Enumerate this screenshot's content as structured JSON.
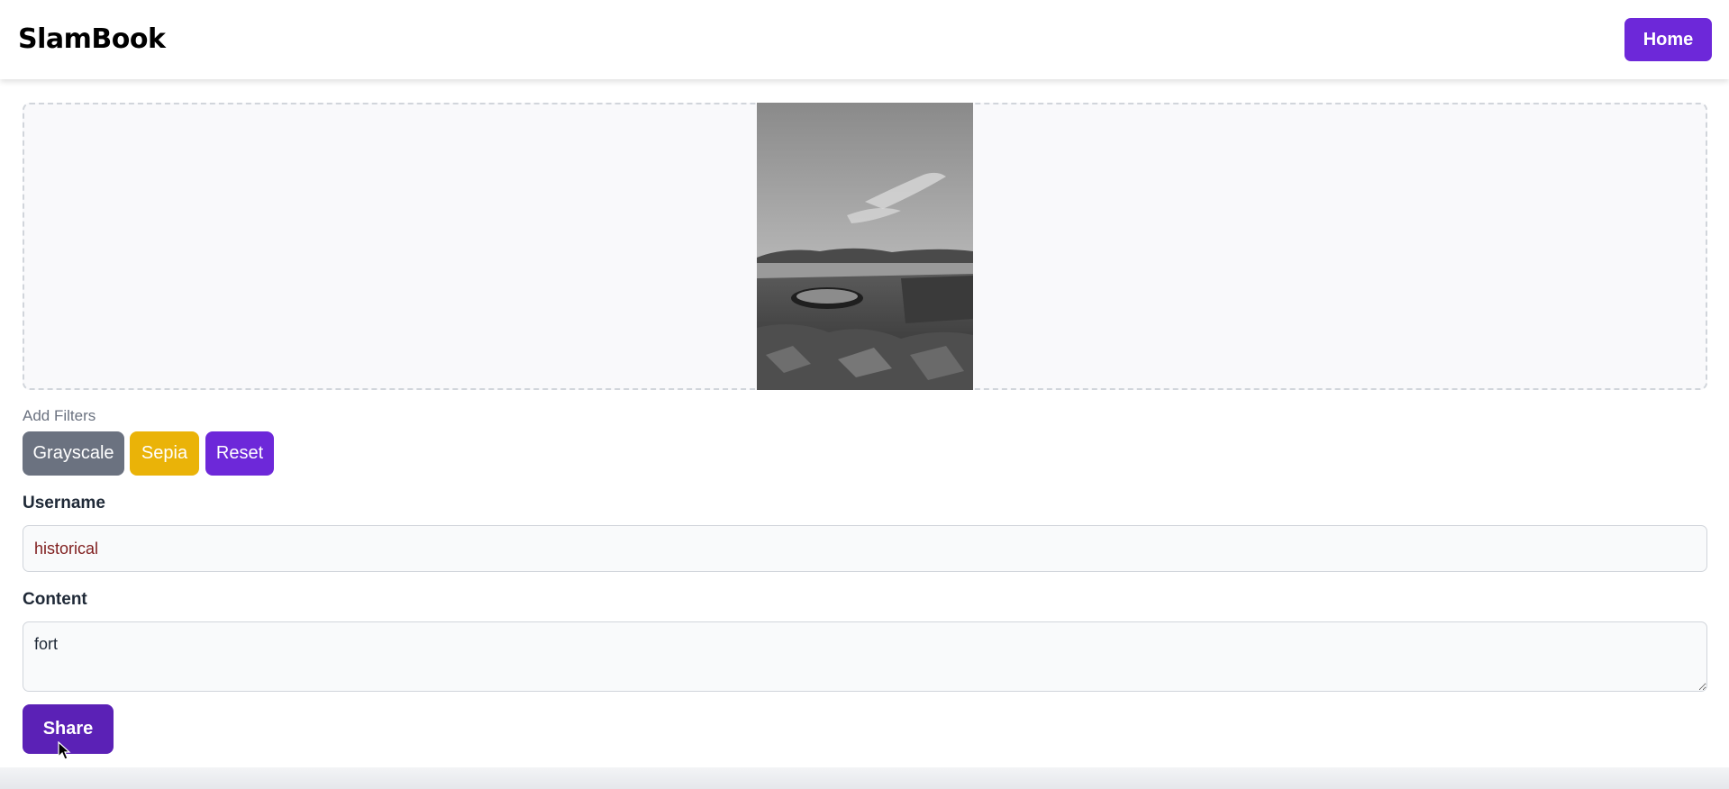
{
  "navbar": {
    "brand": "SlamBook",
    "home_label": "Home"
  },
  "image_preview": {
    "description_icon": "photo-image",
    "filter": "grayscale"
  },
  "filters": {
    "label": "Add Filters",
    "buttons": [
      {
        "label": "Grayscale",
        "color": "#6b7280"
      },
      {
        "label": "Sepia",
        "color": "#eab308"
      },
      {
        "label": "Reset",
        "color": "#6d28d9"
      }
    ]
  },
  "form": {
    "username_label": "Username",
    "username_value": "historical",
    "content_label": "Content",
    "content_value": "fort",
    "share_label": "Share"
  },
  "colors": {
    "accent": "#6d28d9",
    "share": "#5b21b6"
  }
}
